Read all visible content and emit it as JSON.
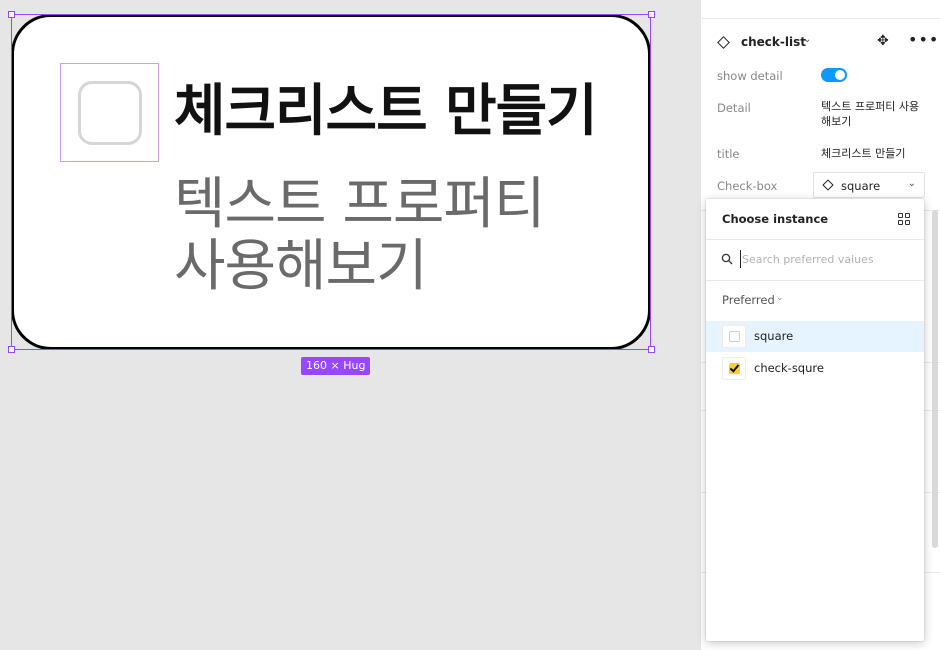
{
  "canvas": {
    "title": "체크리스트 만들기",
    "detail": "텍스트 프로퍼티 사용해보기",
    "size_badge": "160 × Hug"
  },
  "panel": {
    "component_name": "check-list",
    "component_icon": "component-diamond-icon",
    "properties": {
      "show_detail_label": "show detail",
      "show_detail_value": true,
      "detail_label": "Detail",
      "detail_value": "텍스트 프로퍼티 사용해보기",
      "title_label": "title",
      "title_value": "체크리스트 만들기",
      "checkbox_label": "Check-box",
      "checkbox_value": "square"
    }
  },
  "popover": {
    "title": "Choose instance",
    "search_placeholder": "Search preferred values",
    "section_label": "Preferred",
    "options": [
      {
        "label": "square",
        "selected": true,
        "icon": "square-thumbnail-icon"
      },
      {
        "label": "check-squre",
        "selected": false,
        "icon": "checked-square-thumbnail-icon"
      }
    ]
  },
  "colors": {
    "selection": "#9747ff",
    "toggle_on": "#0d99ff",
    "selected_row": "#e5f4ff",
    "check_fill": "#ffc93a"
  }
}
